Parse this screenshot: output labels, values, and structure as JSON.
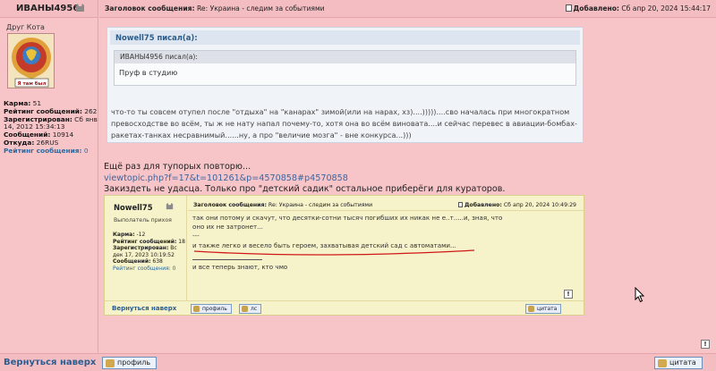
{
  "author": {
    "name": "ИВАНЫ4956",
    "rank": "Друг Кота",
    "avatar_text": "Я там был",
    "profile": [
      {
        "label": "Карма:",
        "value": "51"
      },
      {
        "label": "Рейтинг сообщений:",
        "value": "262"
      },
      {
        "label": "Зарегистрирован:",
        "value": "Сб янв 14, 2012 15:34:13"
      },
      {
        "label": "Сообщений:",
        "value": "10914"
      },
      {
        "label": "Откуда:",
        "value": "26RUS"
      }
    ],
    "rating_link": "Рейтинг сообщения:",
    "rating_value": "0"
  },
  "post": {
    "subject_label": "Заголовок сообщения:",
    "subject": "Re: Украина - следим за событиями",
    "date_label": "Добавлено:",
    "date": "Сб апр 20, 2024 15:44:17"
  },
  "quote_outer": {
    "header": "Nowell75 писал(а):",
    "text": "что-то ты совсем отупел после \"отдыха\" на \"канарах\" зимой(или на нарах, хз)....)))))....сво началась при многократном превосходстве во всём, ты ж не нату напал почему-то, хотя она во всём виновата....и сейчас перевес в авиации-бомбах-ракетах-танках несравнимый......ну, а про \"величие мозга\" - вне конкурса...)))"
  },
  "quote_inner": {
    "header": "ИВАНЫ4956 писал(а):",
    "text": "Пруф в студию"
  },
  "message": {
    "line1": "Ещё раз для тупорых повторю...",
    "link": "viewtopic.php?f=17&t=101261&p=4570858#p4570858",
    "line2": "Закиздеть не удасца. Только про \"детский садик\" остальное приберёги для кураторов."
  },
  "embedded": {
    "name": "Nowell75",
    "rank": "Выполатель прихоя",
    "profile": [
      {
        "label": "Карма:",
        "value": "-12"
      },
      {
        "label": "Рейтинг сообщений:",
        "value": "18"
      },
      {
        "label": "Зарегистрирован:",
        "value": "Вс дек 17, 2023 10:19:52"
      },
      {
        "label": "Сообщений:",
        "value": "638"
      }
    ],
    "rating_link": "Рейтинг сообщения:",
    "rating_value": "0",
    "subject_label": "Заголовок сообщения:",
    "subject": "Re: Украина - следим за событиями",
    "date_label": "Добавлено:",
    "date": "Сб апр 20, 2024 10:49:29",
    "body_line1": "так они потому и скачут, что десятки-сотни тысяч погибших их никак не е..т.....и, зная, что",
    "body_line2": "оно их не затронет...",
    "body_line3": "---",
    "body_line4": "и также легко и весело быть героем, захватывая детский сад с автоматами...",
    "body_line5": "и все теперь знают, кто чмо",
    "back": "Вернуться наверх",
    "btn_profile": "профиль",
    "btn_pm": "лс",
    "btn_quote": "цитата",
    "underline_color": "#d01818"
  },
  "footer": {
    "back": "Вернуться наверх",
    "btn_profile": "профиль",
    "btn_quote": "цитата",
    "report_icon": "!"
  },
  "colors": {
    "background": "#f7c4c8",
    "link": "#3a66a0",
    "quote_header": "#2c5d8a"
  }
}
